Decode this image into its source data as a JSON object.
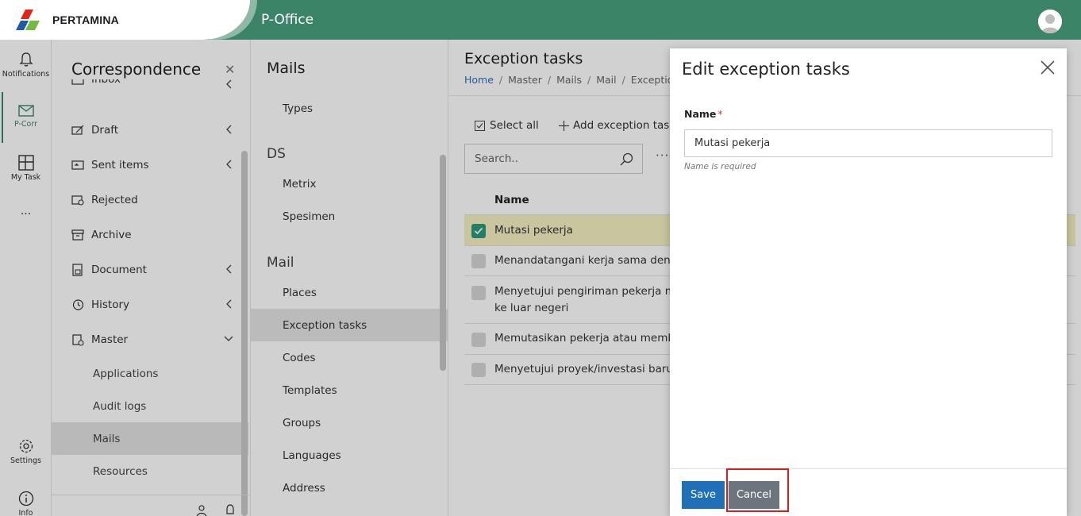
{
  "header": {
    "brand": "PERTAMINA",
    "app_title": "P-Office"
  },
  "rail": {
    "notifications": "Notifications",
    "pcorr": "P-Corr",
    "mytask": "My Task",
    "more": "...",
    "settings": "Settings",
    "info": "Info"
  },
  "correspondence": {
    "title": "Correspondence",
    "items": [
      {
        "label": "Inbox"
      },
      {
        "label": "Draft"
      },
      {
        "label": "Sent items"
      },
      {
        "label": "Rejected"
      },
      {
        "label": "Archive"
      },
      {
        "label": "Document"
      },
      {
        "label": "History"
      },
      {
        "label": "Master"
      }
    ],
    "sub_items": [
      {
        "label": "Applications"
      },
      {
        "label": "Audit logs"
      },
      {
        "label": "Mails"
      },
      {
        "label": "Resources"
      }
    ]
  },
  "mails": {
    "title": "Mails",
    "types_item": "Types",
    "group_ds": "DS",
    "ds_items": [
      {
        "label": "Metrix"
      },
      {
        "label": "Spesimen"
      }
    ],
    "group_mail": "Mail",
    "mail_items": [
      {
        "label": "Places"
      },
      {
        "label": "Exception tasks"
      },
      {
        "label": "Codes"
      },
      {
        "label": "Templates"
      },
      {
        "label": "Groups"
      },
      {
        "label": "Languages"
      },
      {
        "label": "Address"
      }
    ]
  },
  "main": {
    "title": "Exception tasks",
    "breadcrumb": [
      "Home",
      "Master",
      "Mails",
      "Mail",
      "Exception"
    ],
    "select_all": "Select all",
    "add_label": "Add exception tasks",
    "search_placeholder": "Search..",
    "more": "···",
    "column_name": "Name",
    "rows": [
      {
        "line1": "Mutasi pekerja",
        "line2": ""
      },
      {
        "line1": "Menandatangani kerja sama dengan p",
        "line2": ""
      },
      {
        "line1": "Menyetujui pengiriman pekerja melal",
        "line2": "ke luar negeri"
      },
      {
        "line1": "Memutasikan pekerja atau memberik",
        "line2": ""
      },
      {
        "line1": "Menyetujui proyek/investasi baru den",
        "line2": ""
      }
    ]
  },
  "modal": {
    "title": "Edit exception tasks",
    "name_label": "Name",
    "required_mark": "*",
    "name_value": "Mutasi pekerja",
    "name_hint": "Name is required",
    "save_label": "Save",
    "cancel_label": "Cancel"
  },
  "colors": {
    "brand_green": "#3b8467",
    "primary_blue": "#1f6fb9",
    "cancel_gray": "#6c757d",
    "highlight_red": "#e01b1b",
    "selected_row": "#f4f1c2"
  }
}
